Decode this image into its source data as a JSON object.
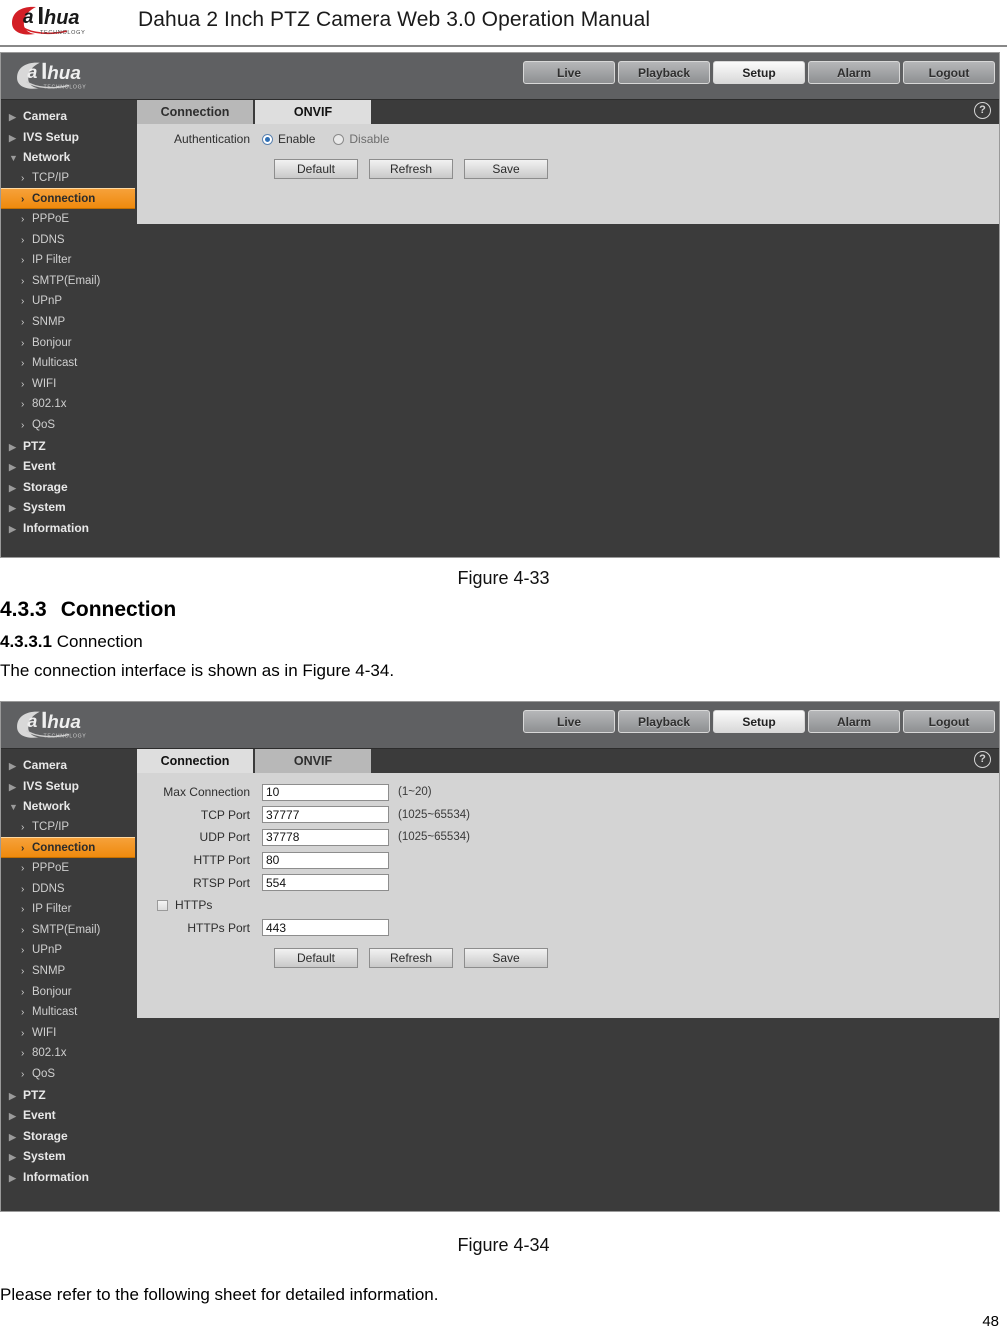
{
  "document": {
    "header_title": "Dahua 2 Inch PTZ Camera Web 3.0 Operation Manual",
    "brand": "alhua",
    "brand_sub": "TECHNOLOGY",
    "figure_33_caption": "Figure 4-33",
    "section_number": "4.3.3",
    "section_title": "Connection",
    "subsection_number": "4.3.3.1",
    "subsection_title": "Connection",
    "intro_paragraph": "The connection interface is shown as in Figure 4-34.",
    "figure_34_caption": "Figure 4-34",
    "closing_paragraph": "Please refer to the following sheet for detailed information.",
    "page_number": "48"
  },
  "ui": {
    "nav_buttons": [
      {
        "label": "Live",
        "active": false
      },
      {
        "label": "Playback",
        "active": false
      },
      {
        "label": "Setup",
        "active": true
      },
      {
        "label": "Alarm",
        "active": false
      },
      {
        "label": "Logout",
        "active": false
      }
    ],
    "help_icon": "?",
    "sidebar": [
      {
        "label": "Camera",
        "type": "group",
        "expanded": false
      },
      {
        "label": "IVS Setup",
        "type": "group",
        "expanded": false
      },
      {
        "label": "Network",
        "type": "group",
        "expanded": true
      },
      {
        "label": "TCP/IP",
        "type": "item",
        "selected": false
      },
      {
        "label": "Connection",
        "type": "item",
        "selected": true
      },
      {
        "label": "PPPoE",
        "type": "item",
        "selected": false
      },
      {
        "label": "DDNS",
        "type": "item",
        "selected": false
      },
      {
        "label": "IP Filter",
        "type": "item",
        "selected": false
      },
      {
        "label": "SMTP(Email)",
        "type": "item",
        "selected": false
      },
      {
        "label": "UPnP",
        "type": "item",
        "selected": false
      },
      {
        "label": "SNMP",
        "type": "item",
        "selected": false
      },
      {
        "label": "Bonjour",
        "type": "item",
        "selected": false
      },
      {
        "label": "Multicast",
        "type": "item",
        "selected": false
      },
      {
        "label": "WIFI",
        "type": "item",
        "selected": false
      },
      {
        "label": "802.1x",
        "type": "item",
        "selected": false
      },
      {
        "label": "QoS",
        "type": "item",
        "selected": false
      },
      {
        "label": "PTZ",
        "type": "group",
        "expanded": false
      },
      {
        "label": "Event",
        "type": "group",
        "expanded": false
      },
      {
        "label": "Storage",
        "type": "group",
        "expanded": false
      },
      {
        "label": "System",
        "type": "group",
        "expanded": false
      },
      {
        "label": "Information",
        "type": "group",
        "expanded": false
      }
    ],
    "tabs": {
      "connection": "Connection",
      "onvif": "ONVIF"
    },
    "buttons": {
      "default": "Default",
      "refresh": "Refresh",
      "save": "Save"
    },
    "colors": {
      "accent_orange": "#ef8a0d",
      "panel_bg": "#d4d4d4",
      "dark_bg": "#3b3b3b",
      "topbar_bg": "#5f6062",
      "radio_blue": "#2f6fb5"
    }
  },
  "screenshot_onvif": {
    "active_tab": "ONVIF",
    "authentication_label": "Authentication",
    "enable_label": "Enable",
    "disable_label": "Disable",
    "authentication_value": "Enable"
  },
  "screenshot_connection": {
    "active_tab": "Connection",
    "fields": [
      {
        "label": "Max Connection",
        "value": "10",
        "hint": "(1~20)"
      },
      {
        "label": "TCP Port",
        "value": "37777",
        "hint": "(1025~65534)"
      },
      {
        "label": "UDP Port",
        "value": "37778",
        "hint": "(1025~65534)"
      },
      {
        "label": "HTTP Port",
        "value": "80",
        "hint": ""
      },
      {
        "label": "RTSP Port",
        "value": "554",
        "hint": ""
      }
    ],
    "https_label": "HTTPs",
    "https_checked": false,
    "https_port_label": "HTTPs Port",
    "https_port_value": "443"
  }
}
